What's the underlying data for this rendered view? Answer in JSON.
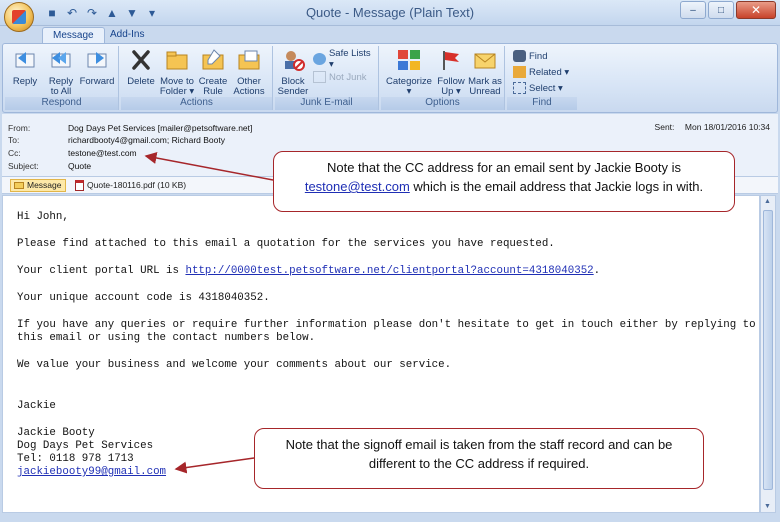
{
  "window": {
    "title": "Quote - Message (Plain Text)",
    "controls": {
      "minimize": "–",
      "maximize": "□",
      "close": "✕"
    }
  },
  "qat": [
    "save-icon",
    "undo-icon",
    "redo-icon",
    "up-icon",
    "down-icon",
    "customize-icon"
  ],
  "tabs": [
    {
      "label": "Message"
    },
    {
      "label": "Add-Ins"
    }
  ],
  "ribbon": {
    "respond": {
      "label": "Respond",
      "reply": "Reply",
      "reply_all_1": "Reply",
      "reply_all_2": "to All",
      "forward": "Forward"
    },
    "actions": {
      "label": "Actions",
      "delete": "Delete",
      "move_1": "Move to",
      "move_2": "Folder ▾",
      "create_1": "Create",
      "create_2": "Rule",
      "other_1": "Other",
      "other_2": "Actions ▾"
    },
    "junk": {
      "label": "Junk E-mail",
      "block_1": "Block",
      "block_2": "Sender",
      "safe_lists": "Safe Lists ▾",
      "not_junk": "Not Junk"
    },
    "options": {
      "label": "Options",
      "categorize_1": "Categorize",
      "categorize_2": "▾",
      "follow_1": "Follow",
      "follow_2": "Up ▾",
      "mark_1": "Mark as",
      "mark_2": "Unread"
    },
    "find": {
      "label": "Find",
      "find": "Find",
      "related": "Related ▾",
      "select": "Select ▾"
    }
  },
  "header": {
    "from_label": "From:",
    "from": "Dog Days Pet Services [mailer@petsoftware.net]",
    "to_label": "To:",
    "to": "richardbooty4@gmail.com; Richard Booty",
    "cc_label": "Cc:",
    "cc": "testone@test.com",
    "subject_label": "Subject:",
    "subject": "Quote",
    "sent_label": "Sent:",
    "sent": "Mon 18/01/2016 10:34"
  },
  "attachments": {
    "message": "Message",
    "file": "Quote-180116.pdf (10 KB)"
  },
  "body": {
    "greeting": "Hi John,",
    "p1": "Please find attached to this email a quotation for the services you have requested.",
    "portal_prefix": "Your client portal URL is ",
    "portal_url": "http://0000test.petsoftware.net/clientportal?account=4318040352",
    "portal_suffix": ".",
    "account_code": "Your unique account code is 4318040352.",
    "queries_1": "If you have any queries or require further information please don't hesitate to get in touch either by replying to",
    "queries_2": "this email or using the contact numbers below.",
    "value": "We value your business and welcome your comments about our service.",
    "signoff": "Jackie",
    "sig_name": "Jackie Booty",
    "sig_company": "Dog Days Pet Services",
    "sig_tel": "Tel: 0118 978 1713",
    "sig_email": "jackiebooty99@gmail.com"
  },
  "callouts": {
    "cc_1": "Note that the CC address for an email sent by Jackie Booty is",
    "cc_email": "testone@test.com",
    "cc_2": " which is the email address that Jackie logs in with.",
    "signoff_1": "Note that the signoff email is taken from the staff record and can be",
    "signoff_2": "different to the CC address if required."
  },
  "colors": {
    "accent": "#15428b",
    "callout_border": "#a6262a",
    "link": "#1f2fb5"
  }
}
